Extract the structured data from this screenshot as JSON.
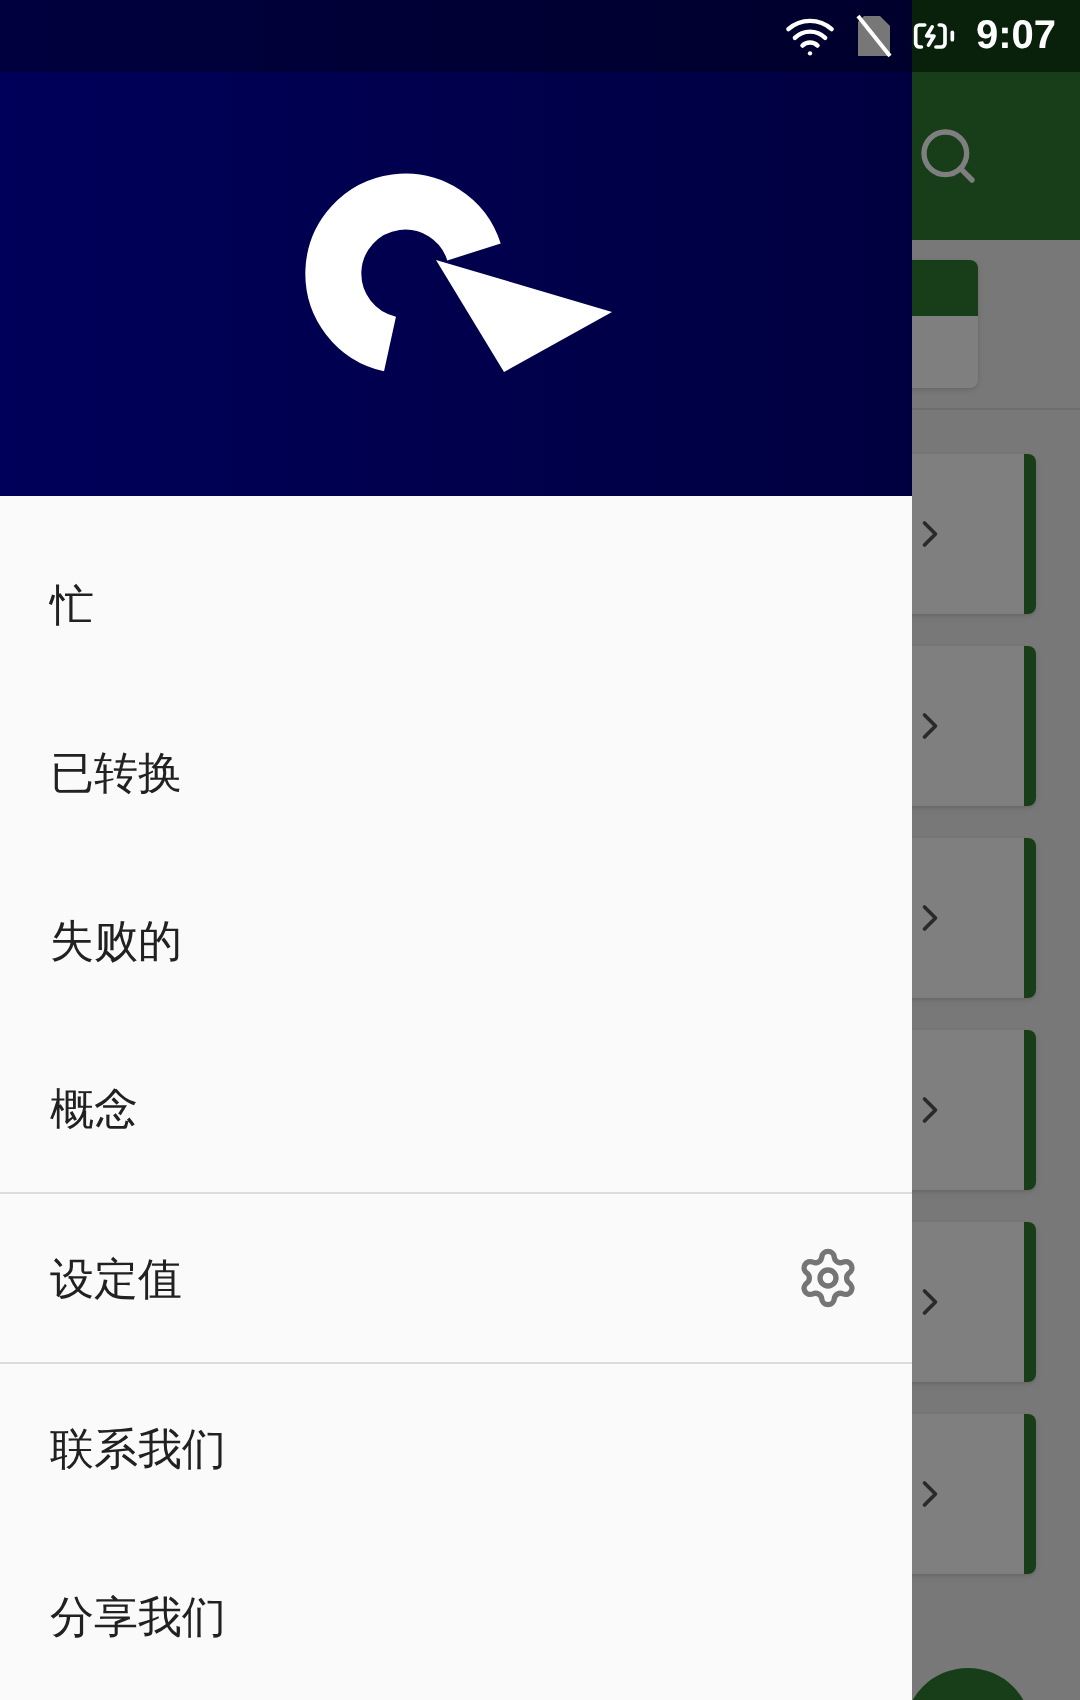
{
  "status_bar": {
    "time": "9:07"
  },
  "drawer": {
    "items": [
      {
        "label": "忙",
        "kind": "plain",
        "divider_before": false
      },
      {
        "label": "已转换",
        "kind": "plain",
        "divider_before": false
      },
      {
        "label": "失败的",
        "kind": "plain",
        "divider_before": false
      },
      {
        "label": "概念",
        "kind": "plain",
        "divider_before": false
      },
      {
        "label": "设定值",
        "kind": "settings",
        "divider_before": true
      },
      {
        "label": "联系我们",
        "kind": "plain",
        "divider_before": true
      },
      {
        "label": "分享我们",
        "kind": "plain",
        "divider_before": false
      }
    ]
  }
}
